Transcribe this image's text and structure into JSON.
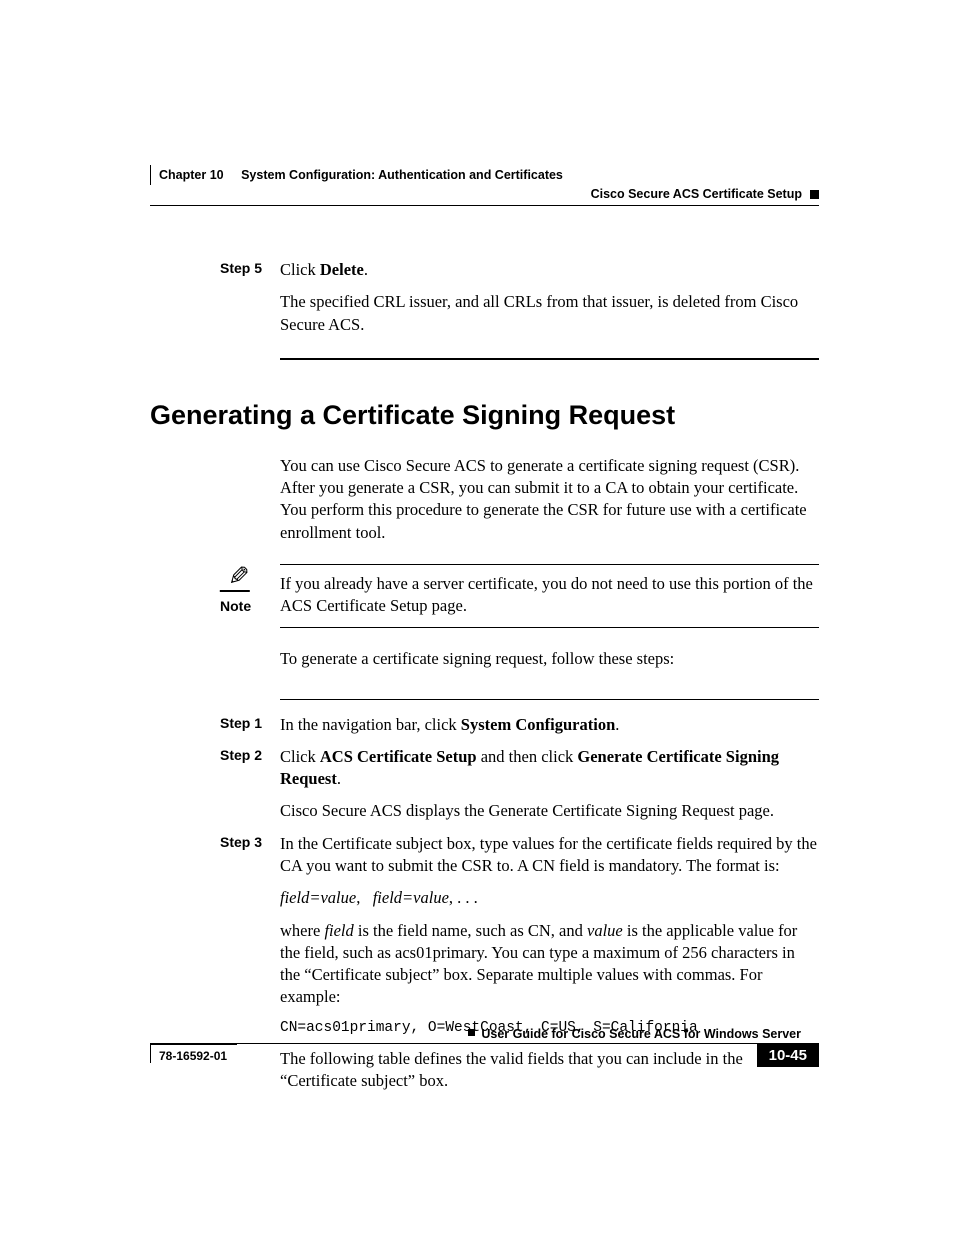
{
  "header": {
    "chapter_label": "Chapter 10",
    "chapter_title": "System Configuration: Authentication and Certificates",
    "section_right": "Cisco Secure ACS Certificate Setup"
  },
  "step5": {
    "label": "Step 5",
    "line1_pre": "Click ",
    "line1_bold": "Delete",
    "line1_post": ".",
    "line2": "The specified CRL issuer, and all CRLs from that issuer, is deleted from Cisco Secure ACS."
  },
  "section_heading": "Generating a Certificate Signing Request",
  "intro": "You can use Cisco Secure ACS to generate a certificate signing request (CSR). After you generate a CSR, you can submit it to a CA to obtain your certificate. You perform this procedure to generate the CSR for future use with a certificate enrollment tool.",
  "note": {
    "label": "Note",
    "text": "If you already have a server certificate, you do not need to use this portion of the ACS Certificate Setup page."
  },
  "mid": "To generate a certificate signing request, follow these steps:",
  "step1": {
    "label": "Step 1",
    "pre": "In the navigation bar, click ",
    "bold": "System Configuration",
    "post": "."
  },
  "step2": {
    "label": "Step 2",
    "pre": "Click ",
    "b1": "ACS Certificate Setup",
    "mid": " and then click ",
    "b2": "Generate Certificate Signing Request",
    "post": ".",
    "after": "Cisco Secure ACS displays the Generate Certificate Signing Request page."
  },
  "step3": {
    "label": "Step 3",
    "p1": "In the Certificate subject box, type values for the certificate fields required by the CA you want to submit the CSR to. A CN field is mandatory. The format is:",
    "format_i1": "field=value",
    "format_sep1": ", ",
    "format_i2": "field=value",
    "format_sep2": ", . . .",
    "p2_pre": "where ",
    "p2_i1": "field",
    "p2_mid1": " is the field name, such as CN, and ",
    "p2_i2": "value",
    "p2_post": " is the applicable value for the field, such as acs01primary. You can type a maximum of 256 characters in the “Certificate subject” box. Separate multiple values with commas. For example:",
    "example": "CN=acs01primary, O=WestCoast, C=US, S=California",
    "p3": "The following table defines the valid fields that you can include in the “Certificate subject” box."
  },
  "footer": {
    "guide": "User Guide for Cisco Secure ACS for Windows Server",
    "docnum": "78-16592-01",
    "pagenum": "10-45"
  }
}
